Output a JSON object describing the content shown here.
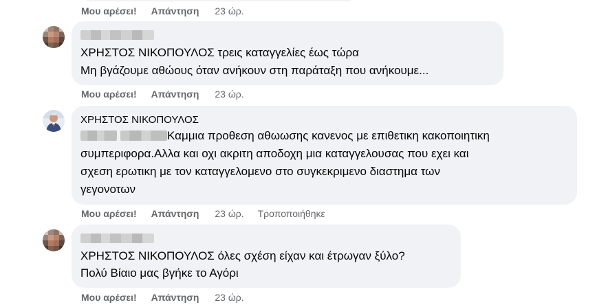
{
  "labels": {
    "like": "Μου αρέσει!",
    "reply": "Απάντηση"
  },
  "comments": [
    {
      "actions": {
        "time": "23 ώρ."
      }
    },
    {
      "mention": "ΧΡΗΣΤΟΣ ΝΙΚΟΠΟΥΛΟΣ",
      "line1": " τρεις καταγγελίες έως τώρα",
      "line2": "Μη βγάζουμε αθώους όταν ανήκουν στη παράταξη που ανήκουμε...",
      "actions": {
        "time": "23 ώρ."
      }
    },
    {
      "author": "ΧΡΗΣΤΟΣ ΝΙΚΟΠΟΥΛΟΣ",
      "line1": "Καμμια προθεση αθωωσης κανενος με επιθετικη κακοποιητικη",
      "line2": "συμπεριφορα.Αλλα και οχι ακριτη αποδοχη μια καταγγελουσας που εχει και",
      "line3": "σχεση ερωτικη με τον καταγγελομενο στο συγκεκριμενο διαστημα των",
      "line4": "γεγονοτων",
      "actions": {
        "time": "23 ώρ.",
        "edited": "Τροποποιήθηκε"
      }
    },
    {
      "mention": "ΧΡΗΣΤΟΣ ΝΙΚΟΠΟΥΛΟΣ",
      "line1": " όλες σχέση είχαν και έτρωγαν ξύλο?",
      "line2": "Πολύ Βίαιο μας βγήκε το Αγόρι",
      "actions": {
        "time": "23 ώρ."
      }
    }
  ],
  "colors": {
    "bubble": "#f0f2f5",
    "meta": "#65676b",
    "text": "#050505"
  }
}
